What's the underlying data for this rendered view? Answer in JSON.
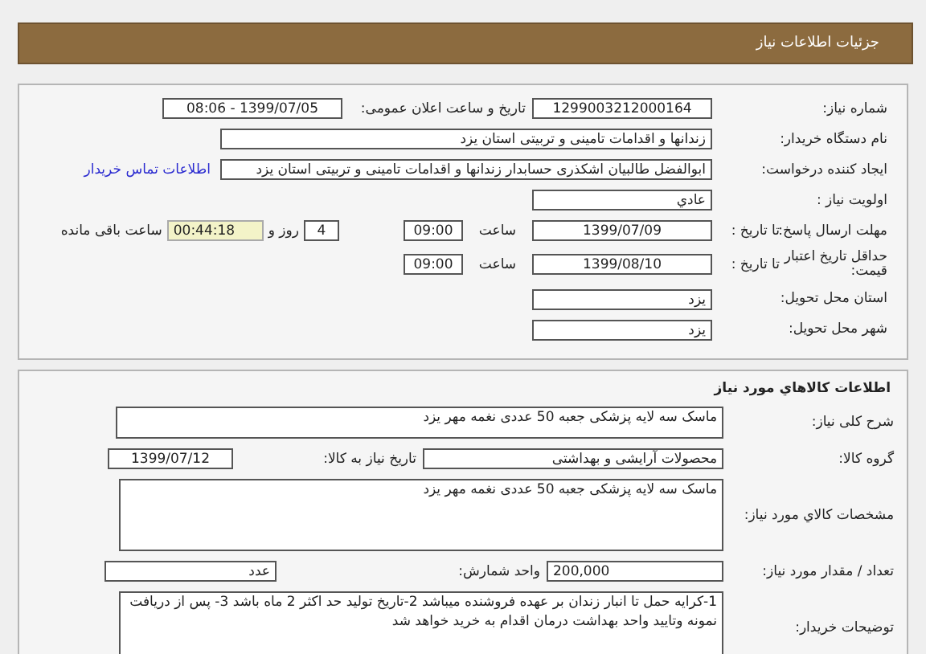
{
  "header": {
    "title": "جزئیات اطلاعات نیاز"
  },
  "need_info": {
    "need_number_label": "شماره نیاز:",
    "need_number": "1299003212000164",
    "announce_label": "تاریخ و ساعت اعلان عمومی:",
    "announce": "1399/07/05 - 08:06",
    "buyer_label": "نام دستگاه خریدار:",
    "buyer": "زندانها و اقدامات تامینی و تربیتی استان یزد",
    "creator_label": "ایجاد کننده درخواست:",
    "creator": "ابوالفضل  طالبیان اشکذری حسابدار زندانها و اقدامات تامینی و تربیتی استان یزد",
    "contact_link": "اطلاعات تماس خریدار",
    "priority_label": "اولویت نیاز :",
    "priority": "عادي",
    "deadline_label": "مهلت ارسال پاسخ:",
    "deadline_to_label": "تا تاریخ :",
    "deadline_date": "1399/07/09",
    "deadline_time_label": "ساعت",
    "deadline_time": "09:00",
    "days": "4",
    "days_label": "روز و",
    "remaining": "00:44:18",
    "remaining_label": "ساعت باقی مانده",
    "validity_label": "حداقل تاریخ اعتبار قیمت:",
    "validity_to_label": "تا تاریخ :",
    "validity_date": "1399/08/10",
    "validity_time_label": "ساعت",
    "validity_time": "09:00",
    "province_label": "استان محل تحویل:",
    "province": "یزد",
    "city_label": "شهر محل تحویل:",
    "city": "یزد"
  },
  "goods": {
    "title": "اطلاعات کالاهاي مورد نیاز",
    "summary_label": "شرح کلی نیاز:",
    "summary": "ماسک سه لایه پزشکی جعبه 50 عددی نغمه مهر یزد",
    "group_label": "گروه کالا:",
    "group": "محصولات آرایشی و بهداشتی",
    "need_date_label": "تاریخ نیاز به کالا:",
    "need_date": "1399/07/12",
    "specs_label": "مشخصات کالاي مورد نیاز:",
    "specs": "ماسک سه لایه پزشکی جعبه 50 عددی نغمه مهر یزد",
    "quantity_label": "تعداد / مقدار مورد نیاز:",
    "quantity": "200,000",
    "unit_label": "واحد شمارش:",
    "unit": "عدد",
    "notes_label": "توضیحات خریدار:",
    "notes": "1-کرایه حمل تا انبار زندان بر عهده فروشنده میباشد 2-تاریخ تولید حد اکثر 2 ماه باشد 3- پس از دریافت نمونه وتایید واحد بهداشت درمان اقدام به خرید خواهد شد"
  }
}
